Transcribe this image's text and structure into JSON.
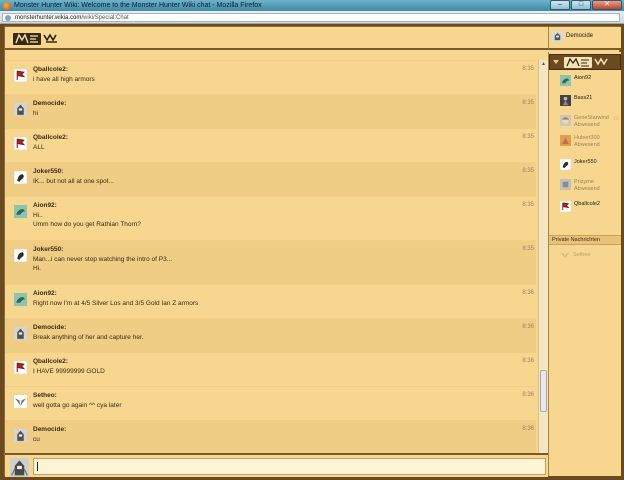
{
  "window": {
    "title": "Monster Hunter Wiki: Welcome to the Monster Hunter Wiki chat - Mozilla Firefox",
    "minimize": "–",
    "maximize": "□",
    "close": "✕"
  },
  "url": {
    "host": "monsterhunter.wikia.com",
    "path": "/wiki/Special:Chat"
  },
  "current_user": "Democide",
  "messages": [
    {
      "user": "Qballcole2:",
      "time": "8:35",
      "lines": [
        "i have all high armors"
      ],
      "avatar": "flag-emblem",
      "alt": false
    },
    {
      "user": "Democide:",
      "time": "8:35",
      "lines": [
        "hi"
      ],
      "avatar": "armor-knight",
      "alt": true
    },
    {
      "user": "Qballcole2:",
      "time": "8:35",
      "lines": [
        "ALL"
      ],
      "avatar": "flag-emblem",
      "alt": false
    },
    {
      "user": "Joker550:",
      "time": "8:35",
      "lines": [
        "IK... but not all at one spot..."
      ],
      "avatar": "creature-white",
      "alt": true
    },
    {
      "user": "Aion92:",
      "time": "8:35",
      "lines": [
        "Hi..",
        "Umm how do you get Rathian Thorn?"
      ],
      "avatar": "dragon-green",
      "alt": false
    },
    {
      "user": "Joker550:",
      "time": "8:35",
      "lines": [
        "Man...i can never stop watching the intro of P3...",
        "Hi."
      ],
      "avatar": "creature-white",
      "alt": true
    },
    {
      "user": "Aion92:",
      "time": "8:36",
      "lines": [
        "Right now I'm at 4/5 Silver Los and 3/5 Gold Ian Z armors"
      ],
      "avatar": "dragon-green",
      "alt": false
    },
    {
      "user": "Democide:",
      "time": "8:36",
      "lines": [
        "Break anything of her and capture her."
      ],
      "avatar": "armor-knight",
      "alt": true
    },
    {
      "user": "Qballcole2:",
      "time": "8:36",
      "lines": [
        "I HAVE 99999999 GOLD"
      ],
      "avatar": "flag-emblem",
      "alt": false
    },
    {
      "user": "Setheo:",
      "time": "8:36",
      "lines": [
        "well gotta go again ^^ cya later"
      ],
      "avatar": "wings-white",
      "alt": false
    },
    {
      "user": "Democide:",
      "time": "8:36",
      "lines": [
        "cu"
      ],
      "avatar": "armor-knight",
      "alt": true
    }
  ],
  "members": [
    {
      "name": "Aion92",
      "status": "",
      "away": false,
      "avatar": "dragon-green",
      "star": false
    },
    {
      "name": "Bass21",
      "status": "",
      "away": false,
      "avatar": "dark-figure",
      "star": false
    },
    {
      "name": "GeneStarwind",
      "status": "Abwesend",
      "away": true,
      "avatar": "anime-face",
      "star": true
    },
    {
      "name": "Hubert300",
      "status": "Abwesend",
      "away": true,
      "avatar": "orange-monster",
      "star": false
    },
    {
      "name": "Joker550",
      "status": "",
      "away": false,
      "avatar": "creature-white",
      "star": false
    },
    {
      "name": "Prizyme",
      "status": "Abwesend",
      "away": true,
      "avatar": "blue-figure",
      "star": false
    },
    {
      "name": "Qballcole2",
      "status": "",
      "away": false,
      "avatar": "flag-emblem",
      "star": false
    }
  ],
  "star_glyph": "☆",
  "private_header": "Private Nachrichten",
  "private_users": [
    {
      "name": "Setheo"
    }
  ],
  "input": {
    "value": "",
    "placeholder": ""
  }
}
